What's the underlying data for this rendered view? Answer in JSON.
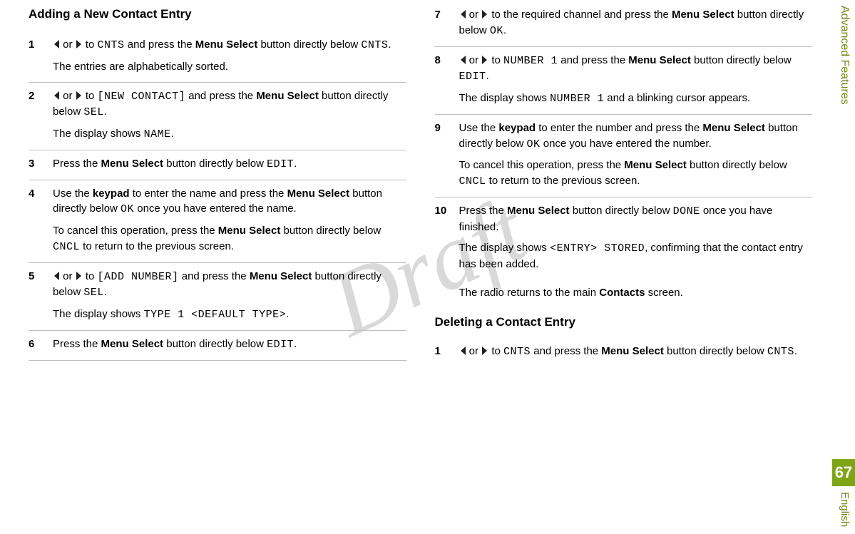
{
  "watermark": "Draft",
  "sidebar": {
    "section": "Advanced Features",
    "page_number": "67",
    "language": "English"
  },
  "left": {
    "heading": "Adding a New Contact Entry",
    "steps": {
      "s1": {
        "num": "1",
        "p1a": " or ",
        "p1b": " to ",
        "code1": "CNTS",
        "p1c": " and press the ",
        "bold1": "Menu Select",
        "p1d": " button directly below ",
        "code2": "CNTS",
        "p1e": ".",
        "p2": "The entries are alphabetically sorted."
      },
      "s2": {
        "num": "2",
        "p1a": " or ",
        "p1b": " to ",
        "code1": "[NEW CONTACT]",
        "p1c": " and press the ",
        "bold1": "Menu Select",
        "p1d": " button directly below ",
        "code2": "SEL",
        "p1e": ".",
        "p2a": "The display shows ",
        "code3": "NAME",
        "p2b": "."
      },
      "s3": {
        "num": "3",
        "p1a": "Press the ",
        "bold1": "Menu Select",
        "p1b": " button directly below ",
        "code1": "EDIT",
        "p1c": "."
      },
      "s4": {
        "num": "4",
        "p1a": "Use the ",
        "bold1": "keypad",
        "p1b": " to enter the name and press the ",
        "bold2": "Menu Select",
        "p1c": " button directly below ",
        "code1": "OK",
        "p1d": " once you have entered the name.",
        "p2a": "To cancel this operation, press the ",
        "bold3": "Menu Select",
        "p2b": " button directly below ",
        "code2": "CNCL",
        "p2c": " to return to the previous screen."
      },
      "s5": {
        "num": "5",
        "p1a": " or ",
        "p1b": " to ",
        "code1": "[ADD NUMBER]",
        "p1c": " and press the ",
        "bold1": "Menu Select",
        "p1d": " button directly below ",
        "code2": "SEL",
        "p1e": ".",
        "p2a": "The display shows ",
        "code3": "TYPE 1 <DEFAULT TYPE>",
        "p2b": "."
      },
      "s6": {
        "num": "6",
        "p1a": "Press the ",
        "bold1": "Menu Select",
        "p1b": " button directly below ",
        "code1": "EDIT",
        "p1c": "."
      }
    }
  },
  "right": {
    "steps": {
      "s7": {
        "num": "7",
        "p1a": " or ",
        "p1b": " to the required channel and press the ",
        "bold1": "Menu Select",
        "p1c": " button directly below ",
        "code1": "OK",
        "p1d": "."
      },
      "s8": {
        "num": "8",
        "p1a": " or ",
        "p1b": " to ",
        "code1": "NUMBER 1",
        "p1c": " and press the ",
        "bold1": "Menu Select",
        "p1d": " button directly below ",
        "code2": "EDIT",
        "p1e": ".",
        "p2a": "The display shows ",
        "code3": "NUMBER 1",
        "p2b": " and a blinking cursor appears."
      },
      "s9": {
        "num": "9",
        "p1a": "Use the ",
        "bold1": "keypad",
        "p1b": " to enter the number and press the ",
        "bold2": "Menu Select",
        "p1c": " button directly below ",
        "code1": "OK",
        "p1d": " once you have entered the number.",
        "p2a": "To cancel this operation, press the ",
        "bold3": "Menu Select",
        "p2b": " button directly below ",
        "code2": "CNCL",
        "p2c": " to return to the previous screen."
      },
      "s10": {
        "num": "10",
        "p1a": "Press the ",
        "bold1": "Menu Select",
        "p1b": " button directly below ",
        "code1": "DONE",
        "p1c": " once you have finished.",
        "p2a": "The display shows ",
        "code2": "<ENTRY> STORED",
        "p2b": ", confirming that the contact entry has been added."
      }
    },
    "after": {
      "p1a": "The radio returns to the main ",
      "bold": "Contacts",
      "p1b": " screen."
    },
    "heading2": "Deleting a Contact Entry",
    "del": {
      "s1": {
        "num": "1",
        "p1a": " or ",
        "p1b": " to ",
        "code1": "CNTS",
        "p1c": " and press the ",
        "bold1": "Menu Select",
        "p1d": " button directly below ",
        "code2": "CNTS",
        "p1e": "."
      }
    }
  }
}
